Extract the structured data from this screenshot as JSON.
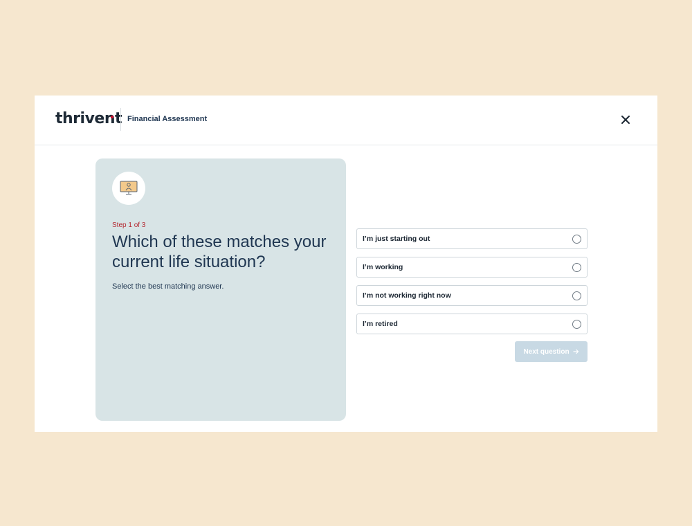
{
  "header": {
    "logo_text": "thrivent",
    "title": "Financial Assessment"
  },
  "card": {
    "icon": "computer-person-icon",
    "step_label": "Step 1 of 3",
    "question": "Which of these matches your current life situation?",
    "hint": "Select the best matching answer."
  },
  "options": [
    {
      "label": "I’m just starting out",
      "selected": false
    },
    {
      "label": "I’m working",
      "selected": false
    },
    {
      "label": "I’m not working right now",
      "selected": false
    },
    {
      "label": "I’m retired",
      "selected": false
    }
  ],
  "next_button": {
    "label": "Next question",
    "icon": "arrow-right-icon",
    "disabled": true
  },
  "colors": {
    "page_bg": "#f6e7cf",
    "card_bg": "#d8e4e6",
    "accent_red": "#b3262e",
    "text_navy": "#1f3651",
    "button_disabled": "#c8d9e4"
  }
}
